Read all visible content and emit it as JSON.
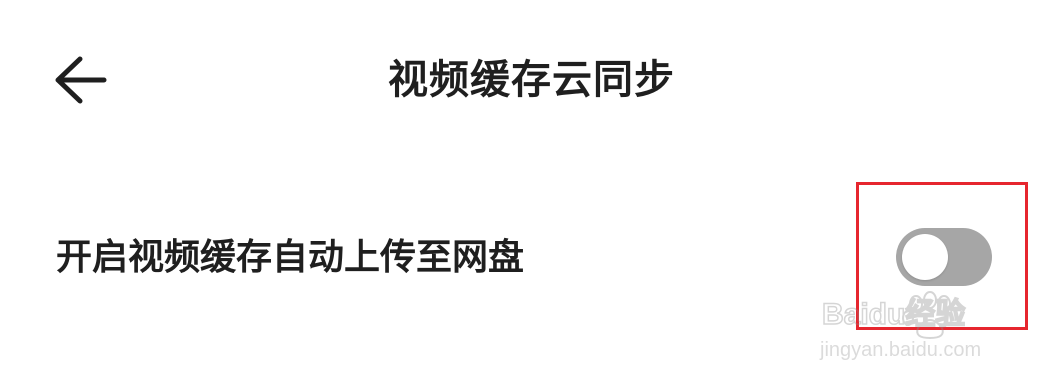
{
  "header": {
    "title": "视频缓存云同步",
    "back_icon": "arrow-left-icon"
  },
  "setting": {
    "label": "开启视频缓存自动上传至网盘",
    "toggle_state": "off",
    "toggle_color_off": "#a6a6a6",
    "knob_color": "#ffffff"
  },
  "annotation": {
    "highlight_color": "#e6262e"
  },
  "watermark": {
    "brand": "Baidu经验",
    "url": "jingyan.baidu.com"
  }
}
